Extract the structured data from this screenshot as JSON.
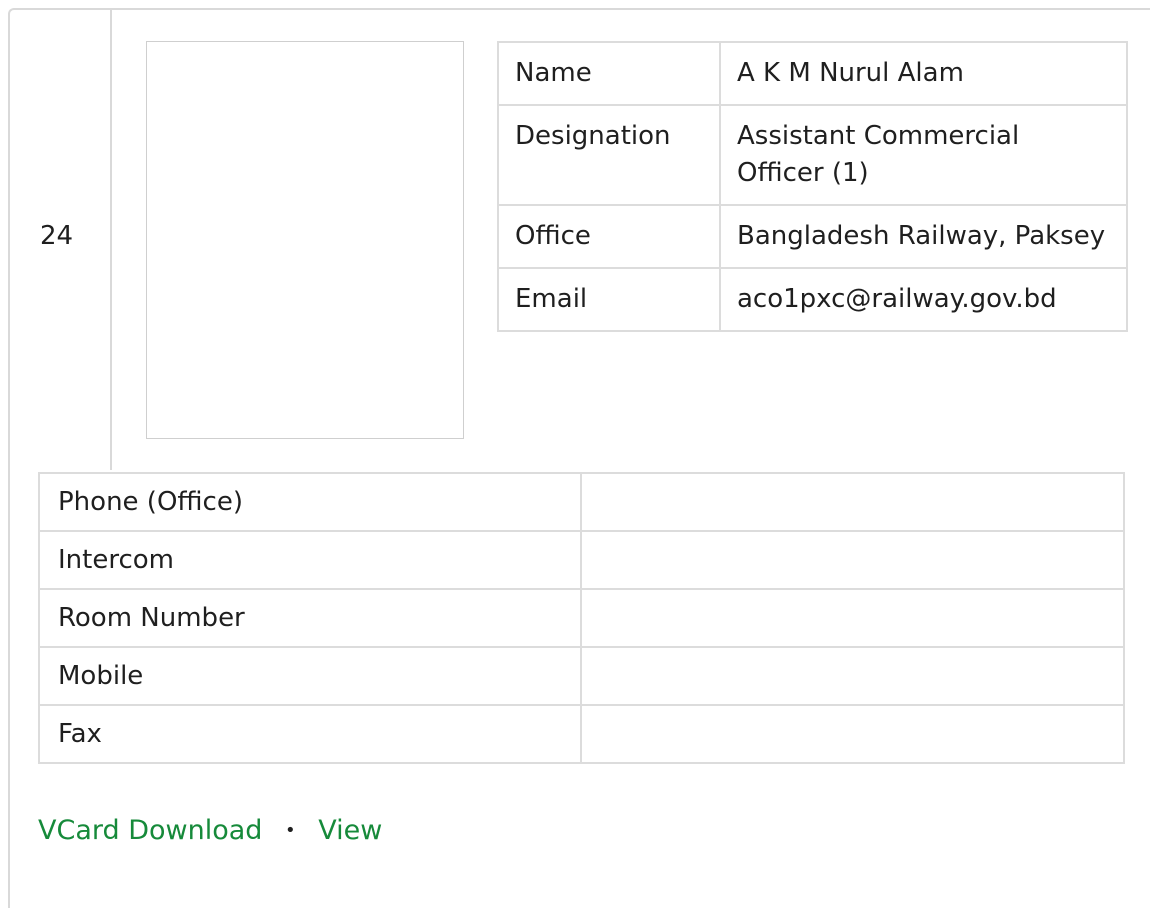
{
  "entry": {
    "serial": "24",
    "info": [
      {
        "label": "Name",
        "value": "A K M Nurul Alam"
      },
      {
        "label": "Designation",
        "value": "Assistant Commercial Officer (1)"
      },
      {
        "label": "Office",
        "value": "Bangladesh Railway, Paksey"
      },
      {
        "label": "Email",
        "value": "aco1pxc@railway.gov.bd"
      }
    ],
    "contact": [
      {
        "label": "Phone (Office)",
        "value": ""
      },
      {
        "label": "Intercom",
        "value": ""
      },
      {
        "label": "Room Number",
        "value": ""
      },
      {
        "label": "Mobile",
        "value": ""
      },
      {
        "label": "Fax",
        "value": ""
      }
    ]
  },
  "links": {
    "vcard": "VCard Download",
    "separator": "•",
    "view": "View"
  },
  "colors": {
    "link": "#168a3a",
    "border": "#dcdcdc"
  }
}
